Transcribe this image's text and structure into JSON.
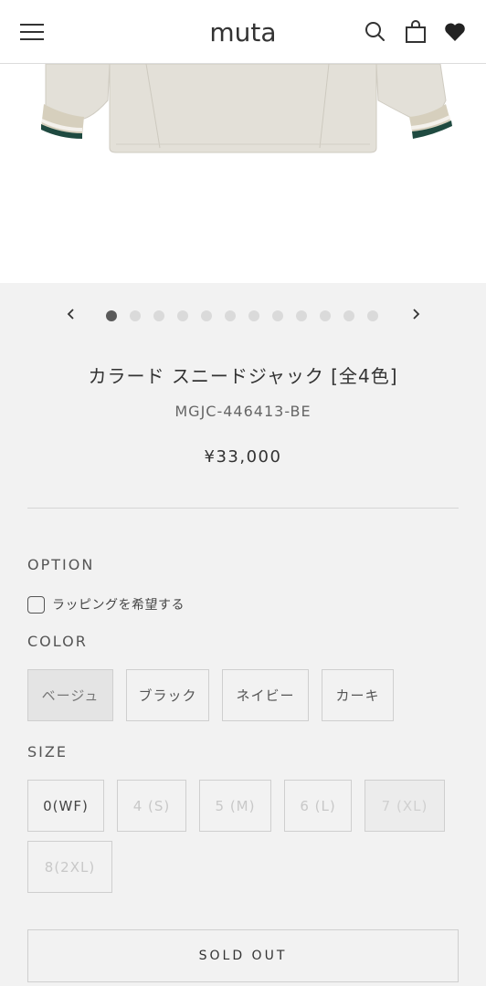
{
  "header": {
    "logo_text": "muta",
    "icons": [
      "menu-icon",
      "search-icon",
      "bag-icon",
      "heart-icon"
    ]
  },
  "product": {
    "image_alt": "jacket-image",
    "title": "カラード スニードジャック [全4色]",
    "sku": "MGJC-446413-BE",
    "price": "¥33,000"
  },
  "carousel": {
    "total_dots": 12,
    "active_index": 0
  },
  "option": {
    "label": "OPTION",
    "wrapping_label": "ラッピングを希望する"
  },
  "color": {
    "label": "COLOR",
    "options": [
      "ベージュ",
      "ブラック",
      "ネイビー",
      "カーキ"
    ],
    "selected": "ベージュ"
  },
  "size": {
    "label": "SIZE",
    "options": [
      "0(WF)",
      "4 (S)",
      "5 (M)",
      "6 (L)",
      "7 (XL)",
      "8(2XL)"
    ]
  },
  "cta": {
    "label": "SOLD OUT"
  },
  "colors": {
    "background": "#f2f2f2",
    "header_bg": "#ffffff",
    "text": "#333333",
    "active_dot": "#5a5a5a",
    "inactive_dot": "#dadada"
  }
}
